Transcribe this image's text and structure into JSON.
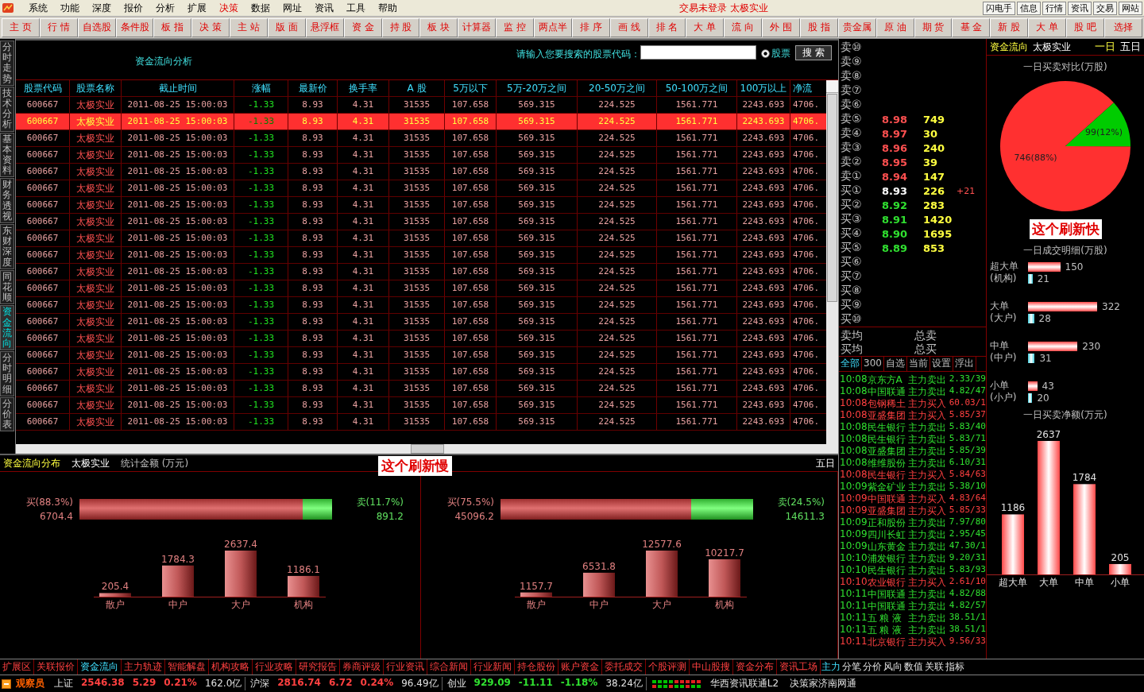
{
  "menu_bar": {
    "items": [
      {
        "label": "系统",
        "selected": false
      },
      {
        "label": "功能",
        "selected": false
      },
      {
        "label": "深度",
        "selected": false
      },
      {
        "label": "报价",
        "selected": false
      },
      {
        "label": "分析",
        "selected": false
      },
      {
        "label": "扩展",
        "selected": false
      },
      {
        "label": "决策",
        "selected": true
      },
      {
        "label": "数据",
        "selected": false
      },
      {
        "label": "网址",
        "selected": false
      },
      {
        "label": "资讯",
        "selected": false
      },
      {
        "label": "工具",
        "selected": false
      },
      {
        "label": "帮助",
        "selected": false
      }
    ],
    "status_text": "交易未登录 太极实业",
    "buttons": [
      "闪电手",
      "信息",
      "行情",
      "资讯",
      "交易",
      "网站"
    ]
  },
  "toolbar": [
    "主 页",
    "行 情",
    "自选股",
    "条件股",
    "板 指",
    "决 策",
    "主 站",
    "版 面",
    "悬浮框",
    "资 金",
    "持 股",
    "板 块",
    "计算器",
    "监 控",
    "两点半",
    "排 序",
    "画 线",
    "排 名",
    "大 单",
    "流 向",
    "外 围",
    "股 指",
    "贵金属",
    "原 油",
    "期 货",
    "基 金",
    "新 股",
    "大 单",
    "股 吧",
    "选择"
  ],
  "side_tabs": [
    {
      "label": "分时走势",
      "selected": false
    },
    {
      "label": "技术分析",
      "selected": false
    },
    {
      "label": "基本资料",
      "selected": false
    },
    {
      "label": "财务透视",
      "selected": false
    },
    {
      "label": "东财深度",
      "selected": false
    },
    {
      "label": "同花顺",
      "selected": false
    },
    {
      "label": "资金流向",
      "selected": true
    },
    {
      "label": "分时明细",
      "selected": false
    },
    {
      "label": "分价表",
      "selected": false
    }
  ],
  "fund_flow_table": {
    "title": "资金流向分析",
    "search": {
      "label": "请输入您要搜索的股票代码：",
      "radio": {
        "label": "股票",
        "selected": true
      },
      "button": "搜 索"
    },
    "columns": [
      "股票代码",
      "股票名称",
      "截止时间",
      "涨幅",
      "最新价",
      "换手率",
      "A 股",
      "5万以下",
      "5万-20万之间",
      "20-50万之间",
      "50-100万之间",
      "100万以上",
      "净流"
    ],
    "rows": [
      {
        "selected": false,
        "cells": [
          "600667",
          "太极实业",
          "2011-08-25 15:00:03",
          "-1.33",
          "8.93",
          "4.31",
          "31535",
          "107.658",
          "569.315",
          "224.525",
          "1561.771",
          "2243.693",
          "4706."
        ]
      },
      {
        "selected": true,
        "cells": [
          "600667",
          "太极实业",
          "2011-08-25 15:00:03",
          "-1.33",
          "8.93",
          "4.31",
          "31535",
          "107.658",
          "569.315",
          "224.525",
          "1561.771",
          "2243.693",
          "4706."
        ]
      },
      {
        "selected": false,
        "cells": [
          "600667",
          "太极实业",
          "2011-08-25 15:00:03",
          "-1.33",
          "8.93",
          "4.31",
          "31535",
          "107.658",
          "569.315",
          "224.525",
          "1561.771",
          "2243.693",
          "4706."
        ]
      },
      {
        "selected": false,
        "cells": [
          "600667",
          "太极实业",
          "2011-08-25 15:00:03",
          "-1.33",
          "8.93",
          "4.31",
          "31535",
          "107.658",
          "569.315",
          "224.525",
          "1561.771",
          "2243.693",
          "4706."
        ]
      },
      {
        "selected": false,
        "cells": [
          "600667",
          "太极实业",
          "2011-08-25 15:00:03",
          "-1.33",
          "8.93",
          "4.31",
          "31535",
          "107.658",
          "569.315",
          "224.525",
          "1561.771",
          "2243.693",
          "4706."
        ]
      },
      {
        "selected": false,
        "cells": [
          "600667",
          "太极实业",
          "2011-08-25 15:00:03",
          "-1.33",
          "8.93",
          "4.31",
          "31535",
          "107.658",
          "569.315",
          "224.525",
          "1561.771",
          "2243.693",
          "4706."
        ]
      },
      {
        "selected": false,
        "cells": [
          "600667",
          "太极实业",
          "2011-08-25 15:00:03",
          "-1.33",
          "8.93",
          "4.31",
          "31535",
          "107.658",
          "569.315",
          "224.525",
          "1561.771",
          "2243.693",
          "4706."
        ]
      },
      {
        "selected": false,
        "cells": [
          "600667",
          "太极实业",
          "2011-08-25 15:00:03",
          "-1.33",
          "8.93",
          "4.31",
          "31535",
          "107.658",
          "569.315",
          "224.525",
          "1561.771",
          "2243.693",
          "4706."
        ]
      },
      {
        "selected": false,
        "cells": [
          "600667",
          "太极实业",
          "2011-08-25 15:00:03",
          "-1.33",
          "8.93",
          "4.31",
          "31535",
          "107.658",
          "569.315",
          "224.525",
          "1561.771",
          "2243.693",
          "4706."
        ]
      },
      {
        "selected": false,
        "cells": [
          "600667",
          "太极实业",
          "2011-08-25 15:00:03",
          "-1.33",
          "8.93",
          "4.31",
          "31535",
          "107.658",
          "569.315",
          "224.525",
          "1561.771",
          "2243.693",
          "4706."
        ]
      },
      {
        "selected": false,
        "cells": [
          "600667",
          "太极实业",
          "2011-08-25 15:00:03",
          "-1.33",
          "8.93",
          "4.31",
          "31535",
          "107.658",
          "569.315",
          "224.525",
          "1561.771",
          "2243.693",
          "4706."
        ]
      },
      {
        "selected": false,
        "cells": [
          "600667",
          "太极实业",
          "2011-08-25 15:00:03",
          "-1.33",
          "8.93",
          "4.31",
          "31535",
          "107.658",
          "569.315",
          "224.525",
          "1561.771",
          "2243.693",
          "4706."
        ]
      },
      {
        "selected": false,
        "cells": [
          "600667",
          "太极实业",
          "2011-08-25 15:00:03",
          "-1.33",
          "8.93",
          "4.31",
          "31535",
          "107.658",
          "569.315",
          "224.525",
          "1561.771",
          "2243.693",
          "4706."
        ]
      },
      {
        "selected": false,
        "cells": [
          "600667",
          "太极实业",
          "2011-08-25 15:00:03",
          "-1.33",
          "8.93",
          "4.31",
          "31535",
          "107.658",
          "569.315",
          "224.525",
          "1561.771",
          "2243.693",
          "4706."
        ]
      },
      {
        "selected": false,
        "cells": [
          "600667",
          "太极实业",
          "2011-08-25 15:00:03",
          "-1.33",
          "8.93",
          "4.31",
          "31535",
          "107.658",
          "569.315",
          "224.525",
          "1561.771",
          "2243.693",
          "4706."
        ]
      },
      {
        "selected": false,
        "cells": [
          "600667",
          "太极实业",
          "2011-08-25 15:00:03",
          "-1.33",
          "8.93",
          "4.31",
          "31535",
          "107.658",
          "569.315",
          "224.525",
          "1561.771",
          "2243.693",
          "4706."
        ]
      },
      {
        "selected": false,
        "cells": [
          "600667",
          "太极实业",
          "2011-08-25 15:00:03",
          "-1.33",
          "8.93",
          "4.31",
          "31535",
          "107.658",
          "569.315",
          "224.525",
          "1561.771",
          "2243.693",
          "4706."
        ]
      },
      {
        "selected": false,
        "cells": [
          "600667",
          "太极实业",
          "2011-08-25 15:00:03",
          "-1.33",
          "8.93",
          "4.31",
          "31535",
          "107.658",
          "569.315",
          "224.525",
          "1561.771",
          "2243.693",
          "4706."
        ]
      },
      {
        "selected": false,
        "cells": [
          "600667",
          "太极实业",
          "2011-08-25 15:00:03",
          "-1.33",
          "8.93",
          "4.31",
          "31535",
          "107.658",
          "569.315",
          "224.525",
          "1561.771",
          "2243.693",
          "4706."
        ]
      },
      {
        "selected": false,
        "cells": [
          "600667",
          "太极实业",
          "2011-08-25 15:00:03",
          "-1.33",
          "8.93",
          "4.31",
          "31535",
          "107.658",
          "569.315",
          "224.525",
          "1561.771",
          "2243.693",
          "4706."
        ]
      }
    ]
  },
  "distribution": {
    "title": "资金流向分布",
    "stock": "太极实业",
    "unit": "统计金额 (万元)",
    "note": "这个刷新慢",
    "period": "五日",
    "panels": [
      {
        "buy_label": "买(88.3%)",
        "buy_amount": "6704.4",
        "sell_label": "卖(11.7%)",
        "sell_amount": "891.2",
        "level": 0.883,
        "chart_data": {
          "type": "bar",
          "categories": [
            "散户",
            "中户",
            "大户",
            "机构"
          ],
          "values": [
            205.4,
            1784.3,
            2637.4,
            1186.1
          ],
          "data_labels": true
        }
      },
      {
        "buy_label": "买(75.5%)",
        "buy_amount": "45096.2",
        "sell_label": "卖(24.5%)",
        "sell_amount": "14611.3",
        "level": 0.755,
        "chart_data": {
          "type": "bar",
          "categories": [
            "散户",
            "中户",
            "大户",
            "机构"
          ],
          "values": [
            1157.7,
            6531.8,
            12577.6,
            10217.7
          ],
          "data_labels": true
        }
      }
    ]
  },
  "order_book": {
    "sells": [
      {
        "label": "卖⑩"
      },
      {
        "label": "卖⑨"
      },
      {
        "label": "卖⑧"
      },
      {
        "label": "卖⑦"
      },
      {
        "label": "卖⑥"
      },
      {
        "label": "卖⑤",
        "price": "8.98",
        "volume": "749",
        "color": "#ff5050"
      },
      {
        "label": "卖④",
        "price": "8.97",
        "volume": "30",
        "color": "#ff5050"
      },
      {
        "label": "卖③",
        "price": "8.96",
        "volume": "240",
        "color": "#ff5050"
      },
      {
        "label": "卖②",
        "price": "8.95",
        "volume": "39",
        "color": "#ff5050"
      },
      {
        "label": "卖①",
        "price": "8.94",
        "volume": "147",
        "color": "#ff5050"
      }
    ],
    "buys": [
      {
        "label": "买①",
        "price": "8.93",
        "volume": "226",
        "change": "+21",
        "color": "#ffffff"
      },
      {
        "label": "买②",
        "price": "8.92",
        "volume": "283",
        "color": "#30e030"
      },
      {
        "label": "买③",
        "price": "8.91",
        "volume": "1420",
        "color": "#30e030"
      },
      {
        "label": "买④",
        "price": "8.90",
        "volume": "1695",
        "color": "#30e030"
      },
      {
        "label": "买⑤",
        "price": "8.89",
        "volume": "853",
        "color": "#30e030"
      },
      {
        "label": "买⑥"
      },
      {
        "label": "买⑦"
      },
      {
        "label": "买⑧"
      },
      {
        "label": "买⑨"
      },
      {
        "label": "买⑩"
      }
    ],
    "summary": [
      [
        "卖均",
        "总卖"
      ],
      [
        "买均",
        "总买"
      ]
    ],
    "tabs": [
      {
        "label": "全部",
        "selected": true
      },
      {
        "label": "300",
        "selected": false
      },
      {
        "label": "自选",
        "selected": false
      },
      {
        "label": "当前",
        "selected": false
      },
      {
        "label": "设置",
        "selected": false
      },
      {
        "label": "浮出",
        "selected": false
      }
    ],
    "ticks": [
      {
        "time": "10:08",
        "name": "京东方A",
        "action": "主力卖出",
        "price": "2.33/39",
        "color": "#30e030"
      },
      {
        "time": "10:08",
        "name": "中国联通",
        "action": "主力卖出",
        "price": "4.82/47",
        "color": "#30e030"
      },
      {
        "time": "10:08",
        "name": "包钢稀土",
        "action": "主力买入",
        "price": "60.03/1",
        "color": "#ff4040"
      },
      {
        "time": "10:08",
        "name": "亚盛集团",
        "action": "主力买入",
        "price": "5.85/37",
        "color": "#ff4040"
      },
      {
        "time": "10:08",
        "name": "民生银行",
        "action": "主力卖出",
        "price": "5.83/40",
        "color": "#30e030"
      },
      {
        "time": "10:08",
        "name": "民生银行",
        "action": "主力卖出",
        "price": "5.83/71",
        "color": "#30e030"
      },
      {
        "time": "10:08",
        "name": "亚盛集团",
        "action": "主力卖出",
        "price": "5.85/39",
        "color": "#30e030"
      },
      {
        "time": "10:08",
        "name": "维维股份",
        "action": "主力卖出",
        "price": "6.10/31",
        "color": "#30e030"
      },
      {
        "time": "10:08",
        "name": "民生银行",
        "action": "主力买入",
        "price": "5.84/63",
        "color": "#ff4040"
      },
      {
        "time": "10:09",
        "name": "紫金矿业",
        "action": "主力卖出",
        "price": "5.38/10",
        "color": "#30e030"
      },
      {
        "time": "10:09",
        "name": "中国联通",
        "action": "主力买入",
        "price": "4.83/64",
        "color": "#ff4040"
      },
      {
        "time": "10:09",
        "name": "亚盛集团",
        "action": "主力买入",
        "price": "5.85/33",
        "color": "#ff4040"
      },
      {
        "time": "10:09",
        "name": "正和股份",
        "action": "主力卖出",
        "price": "7.97/80",
        "color": "#30e030"
      },
      {
        "time": "10:09",
        "name": "四川长虹",
        "action": "主力卖出",
        "price": "2.95/45",
        "color": "#30e030"
      },
      {
        "time": "10:09",
        "name": "山东黄金",
        "action": "主力卖出",
        "price": "47.30/1",
        "color": "#30e030"
      },
      {
        "time": "10:10",
        "name": "浦发银行",
        "action": "主力卖出",
        "price": "9.20/31",
        "color": "#30e030"
      },
      {
        "time": "10:10",
        "name": "民生银行",
        "action": "主力卖出",
        "price": "5.83/93",
        "color": "#30e030"
      },
      {
        "time": "10:10",
        "name": "农业银行",
        "action": "主力买入",
        "price": "2.61/10",
        "color": "#ff4040"
      },
      {
        "time": "10:11",
        "name": "中国联通",
        "action": "主力卖出",
        "price": "4.82/88",
        "color": "#30e030"
      },
      {
        "time": "10:11",
        "name": "中国联通",
        "action": "主力卖出",
        "price": "4.82/57",
        "color": "#30e030"
      },
      {
        "time": "10:11",
        "name": "五 粮 液",
        "action": "主力卖出",
        "price": "38.51/1",
        "color": "#30e030"
      },
      {
        "time": "10:11",
        "name": "五 粮 液",
        "action": "主力卖出",
        "price": "38.51/1",
        "color": "#30e030"
      },
      {
        "time": "10:11",
        "name": "北京银行",
        "action": "主力买入",
        "price": "9.56/33",
        "color": "#ff4040"
      }
    ]
  },
  "fund_flow_panel": {
    "title": "资金流向",
    "stock": "太极实业",
    "periods": [
      {
        "label": "一日",
        "selected": true
      },
      {
        "label": "五日",
        "selected": false
      }
    ],
    "pie_title": "一日买卖对比(万股)",
    "pie": {
      "chart_data": {
        "type": "pie",
        "values": [
          746,
          99
        ],
        "value_labels": [
          "746(88%)",
          "99(12%)"
        ]
      }
    },
    "note": "这个刷新快",
    "detail_title": "一日成交明细(万股)",
    "details": [
      {
        "label": "超大单",
        "sublabel": "(机构)",
        "upper": "150",
        "lower": "21"
      },
      {
        "label": "大单",
        "sublabel": "(大户)",
        "upper": "322",
        "lower": "28"
      },
      {
        "label": "中单",
        "sublabel": "(中户)",
        "upper": "230",
        "lower": "31"
      },
      {
        "label": "小单",
        "sublabel": "(小户)",
        "upper": "43",
        "lower": "20"
      }
    ],
    "net_title": "一日买卖净额(万元)",
    "net": {
      "chart_data": {
        "type": "bar",
        "categories": [
          "超大单",
          "大单",
          "中单",
          "小单"
        ],
        "values": [
          1186,
          2637,
          1784,
          205
        ],
        "data_labels": true
      }
    }
  },
  "bottom_tabs": [
    {
      "label": "扩展区",
      "selected": false
    },
    {
      "label": "关联报价",
      "selected": false
    },
    {
      "label": "资金流向",
      "selected": true
    },
    {
      "label": "主力轨迹",
      "selected": false
    },
    {
      "label": "智能解盘",
      "selected": false
    },
    {
      "label": "机构攻略",
      "selected": false
    },
    {
      "label": "行业攻略",
      "selected": false
    },
    {
      "label": "研究报告",
      "selected": false
    },
    {
      "label": "券商评级",
      "selected": false
    },
    {
      "label": "行业资讯",
      "selected": false
    },
    {
      "label": "综合新闻",
      "selected": false
    },
    {
      "label": "行业新闻",
      "selected": false
    },
    {
      "label": "持仓股份",
      "selected": false
    },
    {
      "label": "账户资金",
      "selected": false
    },
    {
      "label": "委托成交",
      "selected": false
    },
    {
      "label": "个股评测",
      "selected": false
    },
    {
      "label": "中山股搜",
      "selected": false
    },
    {
      "label": "资金分布",
      "selected": false
    },
    {
      "label": "资讯工场",
      "selected": false
    }
  ],
  "side_panel_tabs": [
    {
      "label": "主力",
      "selected": true
    },
    {
      "label": "分笔",
      "selected": false
    },
    {
      "label": "分价",
      "selected": false
    },
    {
      "label": "风向",
      "selected": false
    },
    {
      "label": "数值",
      "selected": false
    },
    {
      "label": "关联",
      "selected": false
    },
    {
      "label": "指标",
      "selected": false
    }
  ],
  "status_bar": {
    "user": "观察员",
    "indices": [
      {
        "name": "上证",
        "value": "2546.38",
        "change": "5.29",
        "pct": "0.21%",
        "amount": "162.0亿",
        "color": "#ff4040"
      },
      {
        "name": "沪深",
        "value": "2816.74",
        "change": "6.72",
        "pct": "0.24%",
        "amount": "96.49亿",
        "color": "#ff4040"
      },
      {
        "name": "创业",
        "value": "929.09",
        "change": "-11.11",
        "pct": "-1.18%",
        "amount": "38.24亿",
        "color": "#30e030"
      }
    ],
    "feeds": [
      "华西资讯联通L2",
      "决策家济南网通"
    ]
  }
}
